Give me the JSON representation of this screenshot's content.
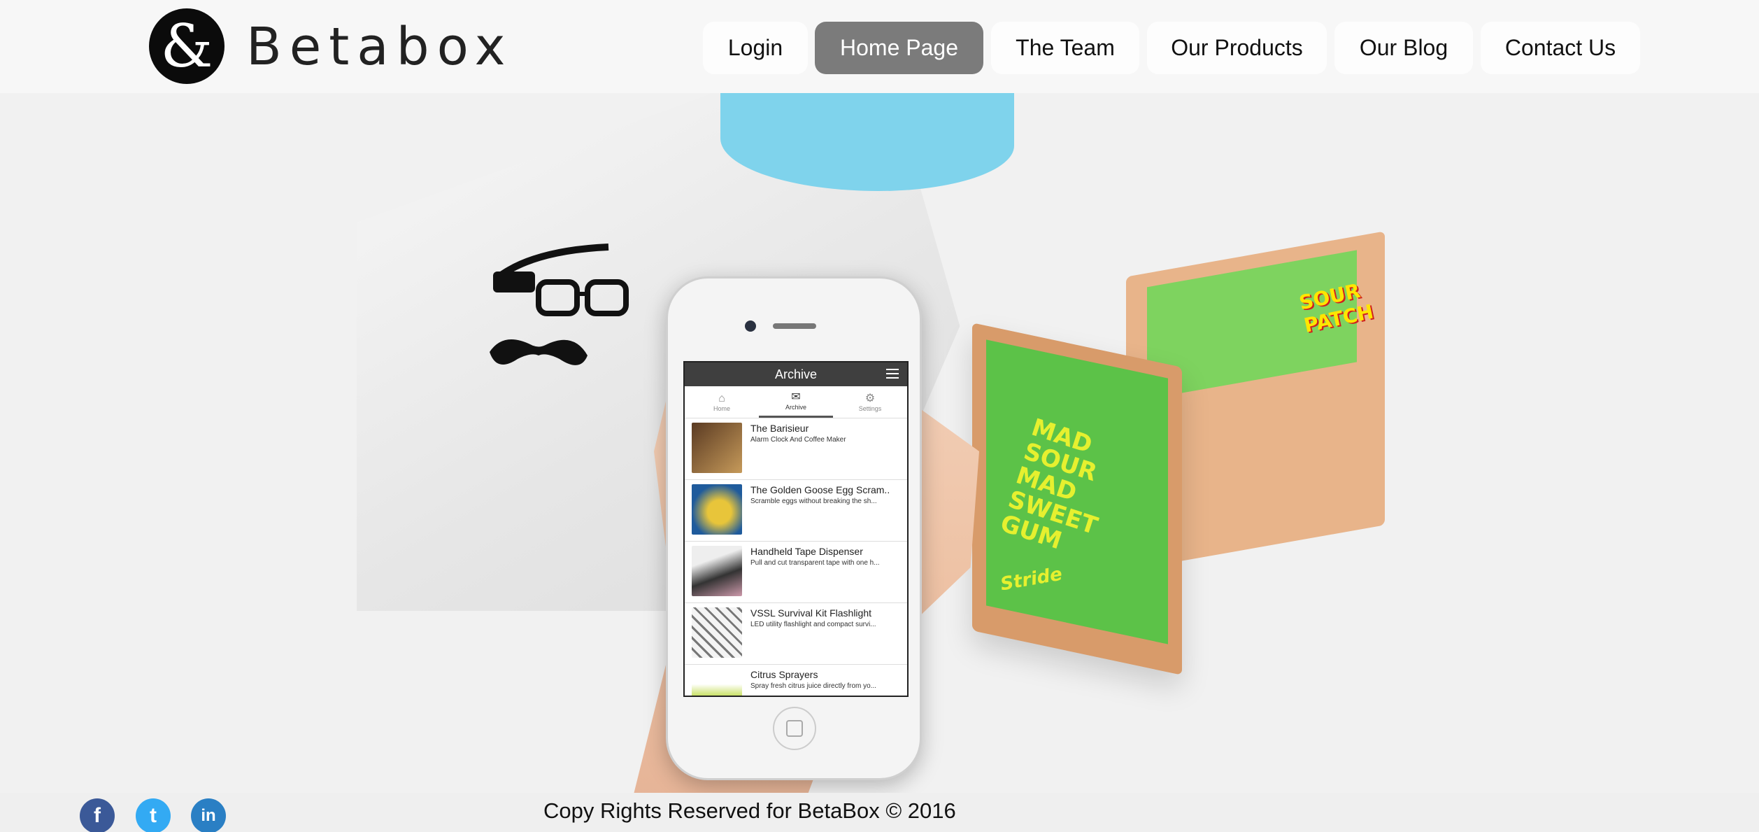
{
  "brand": {
    "logo_glyph": "&",
    "name": "Betabox"
  },
  "nav": {
    "items": [
      {
        "label": "Login"
      },
      {
        "label": "Home Page",
        "active": true
      },
      {
        "label": "The Team"
      },
      {
        "label": "Our Products"
      },
      {
        "label": "Our Blog"
      },
      {
        "label": "Contact Us"
      }
    ]
  },
  "hero": {
    "phone_app": {
      "title": "Archive",
      "tabs": [
        {
          "label": "Home",
          "icon": "home-icon"
        },
        {
          "label": "Archive",
          "icon": "inbox-icon",
          "active": true
        },
        {
          "label": "Settings",
          "icon": "gear-icon"
        }
      ],
      "items": [
        {
          "title": "The Barisieur",
          "subtitle": "Alarm Clock And Coffee Maker"
        },
        {
          "title": "The Golden Goose Egg Scram..",
          "subtitle": "Scramble eggs without breaking the sh..."
        },
        {
          "title": "Handheld Tape Dispenser",
          "subtitle": "Pull and cut transparent tape with one h..."
        },
        {
          "title": "VSSL Survival Kit Flashlight",
          "subtitle": "LED utility flashlight and compact survi..."
        },
        {
          "title": "Citrus Sprayers",
          "subtitle": "Spray fresh citrus juice directly from yo..."
        }
      ]
    },
    "box_text": {
      "lid": "MAD SOUR MAD SWEET GUM",
      "lid_brand": "Stride",
      "pack": "SOUR PATCH"
    }
  },
  "footer": {
    "social": [
      {
        "name": "facebook-icon",
        "glyph": "f",
        "color": "#3b5998"
      },
      {
        "name": "twitter-icon",
        "glyph": "t",
        "color": "#33aaf3"
      },
      {
        "name": "linkedin-icon",
        "glyph": "in",
        "color": "#2a7fc4"
      }
    ],
    "copyright": "Copy Rights Reserved for BetaBox © 2016"
  }
}
